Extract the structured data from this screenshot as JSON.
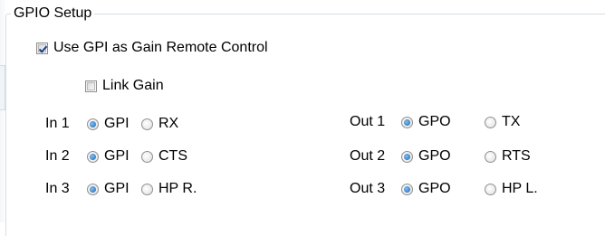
{
  "groupbox": {
    "title": "GPIO Setup"
  },
  "use_gpi": {
    "label": "Use GPI as Gain Remote Control",
    "checked": true
  },
  "link_gain": {
    "label": "Link Gain",
    "checked": false
  },
  "inputs": [
    {
      "label": "In 1",
      "opt_a": "GPI",
      "opt_b": "RX",
      "selected": "GPI"
    },
    {
      "label": "In 2",
      "opt_a": "GPI",
      "opt_b": "CTS",
      "selected": "GPI"
    },
    {
      "label": "In 3",
      "opt_a": "GPI",
      "opt_b": "HP R.",
      "selected": "GPI"
    }
  ],
  "outputs": [
    {
      "label": "Out 1",
      "opt_a": "GPO",
      "opt_b": "TX",
      "selected": "GPO"
    },
    {
      "label": "Out 2",
      "opt_a": "GPO",
      "opt_b": "RTS",
      "selected": "GPO"
    },
    {
      "label": "Out 3",
      "opt_a": "GPO",
      "opt_b": "HP L.",
      "selected": "GPO"
    }
  ],
  "colors": {
    "border": "#d5dfe5",
    "radio_fill": "#1b5fa6",
    "check_mark": "#1a3f8f"
  }
}
